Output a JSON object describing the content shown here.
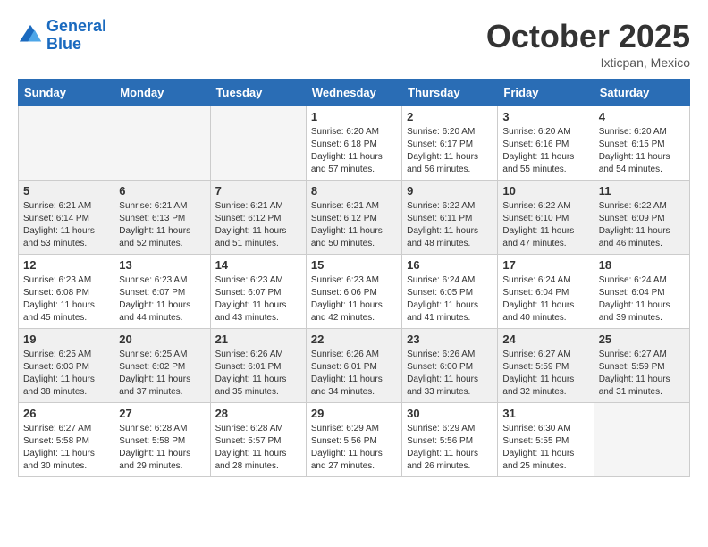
{
  "header": {
    "logo_line1": "General",
    "logo_line2": "Blue",
    "month": "October 2025",
    "location": "Ixticpan, Mexico"
  },
  "days_of_week": [
    "Sunday",
    "Monday",
    "Tuesday",
    "Wednesday",
    "Thursday",
    "Friday",
    "Saturday"
  ],
  "weeks": [
    [
      {
        "day": "",
        "info": ""
      },
      {
        "day": "",
        "info": ""
      },
      {
        "day": "",
        "info": ""
      },
      {
        "day": "1",
        "info": "Sunrise: 6:20 AM\nSunset: 6:18 PM\nDaylight: 11 hours and 57 minutes."
      },
      {
        "day": "2",
        "info": "Sunrise: 6:20 AM\nSunset: 6:17 PM\nDaylight: 11 hours and 56 minutes."
      },
      {
        "day": "3",
        "info": "Sunrise: 6:20 AM\nSunset: 6:16 PM\nDaylight: 11 hours and 55 minutes."
      },
      {
        "day": "4",
        "info": "Sunrise: 6:20 AM\nSunset: 6:15 PM\nDaylight: 11 hours and 54 minutes."
      }
    ],
    [
      {
        "day": "5",
        "info": "Sunrise: 6:21 AM\nSunset: 6:14 PM\nDaylight: 11 hours and 53 minutes."
      },
      {
        "day": "6",
        "info": "Sunrise: 6:21 AM\nSunset: 6:13 PM\nDaylight: 11 hours and 52 minutes."
      },
      {
        "day": "7",
        "info": "Sunrise: 6:21 AM\nSunset: 6:12 PM\nDaylight: 11 hours and 51 minutes."
      },
      {
        "day": "8",
        "info": "Sunrise: 6:21 AM\nSunset: 6:12 PM\nDaylight: 11 hours and 50 minutes."
      },
      {
        "day": "9",
        "info": "Sunrise: 6:22 AM\nSunset: 6:11 PM\nDaylight: 11 hours and 48 minutes."
      },
      {
        "day": "10",
        "info": "Sunrise: 6:22 AM\nSunset: 6:10 PM\nDaylight: 11 hours and 47 minutes."
      },
      {
        "day": "11",
        "info": "Sunrise: 6:22 AM\nSunset: 6:09 PM\nDaylight: 11 hours and 46 minutes."
      }
    ],
    [
      {
        "day": "12",
        "info": "Sunrise: 6:23 AM\nSunset: 6:08 PM\nDaylight: 11 hours and 45 minutes."
      },
      {
        "day": "13",
        "info": "Sunrise: 6:23 AM\nSunset: 6:07 PM\nDaylight: 11 hours and 44 minutes."
      },
      {
        "day": "14",
        "info": "Sunrise: 6:23 AM\nSunset: 6:07 PM\nDaylight: 11 hours and 43 minutes."
      },
      {
        "day": "15",
        "info": "Sunrise: 6:23 AM\nSunset: 6:06 PM\nDaylight: 11 hours and 42 minutes."
      },
      {
        "day": "16",
        "info": "Sunrise: 6:24 AM\nSunset: 6:05 PM\nDaylight: 11 hours and 41 minutes."
      },
      {
        "day": "17",
        "info": "Sunrise: 6:24 AM\nSunset: 6:04 PM\nDaylight: 11 hours and 40 minutes."
      },
      {
        "day": "18",
        "info": "Sunrise: 6:24 AM\nSunset: 6:04 PM\nDaylight: 11 hours and 39 minutes."
      }
    ],
    [
      {
        "day": "19",
        "info": "Sunrise: 6:25 AM\nSunset: 6:03 PM\nDaylight: 11 hours and 38 minutes."
      },
      {
        "day": "20",
        "info": "Sunrise: 6:25 AM\nSunset: 6:02 PM\nDaylight: 11 hours and 37 minutes."
      },
      {
        "day": "21",
        "info": "Sunrise: 6:26 AM\nSunset: 6:01 PM\nDaylight: 11 hours and 35 minutes."
      },
      {
        "day": "22",
        "info": "Sunrise: 6:26 AM\nSunset: 6:01 PM\nDaylight: 11 hours and 34 minutes."
      },
      {
        "day": "23",
        "info": "Sunrise: 6:26 AM\nSunset: 6:00 PM\nDaylight: 11 hours and 33 minutes."
      },
      {
        "day": "24",
        "info": "Sunrise: 6:27 AM\nSunset: 5:59 PM\nDaylight: 11 hours and 32 minutes."
      },
      {
        "day": "25",
        "info": "Sunrise: 6:27 AM\nSunset: 5:59 PM\nDaylight: 11 hours and 31 minutes."
      }
    ],
    [
      {
        "day": "26",
        "info": "Sunrise: 6:27 AM\nSunset: 5:58 PM\nDaylight: 11 hours and 30 minutes."
      },
      {
        "day": "27",
        "info": "Sunrise: 6:28 AM\nSunset: 5:58 PM\nDaylight: 11 hours and 29 minutes."
      },
      {
        "day": "28",
        "info": "Sunrise: 6:28 AM\nSunset: 5:57 PM\nDaylight: 11 hours and 28 minutes."
      },
      {
        "day": "29",
        "info": "Sunrise: 6:29 AM\nSunset: 5:56 PM\nDaylight: 11 hours and 27 minutes."
      },
      {
        "day": "30",
        "info": "Sunrise: 6:29 AM\nSunset: 5:56 PM\nDaylight: 11 hours and 26 minutes."
      },
      {
        "day": "31",
        "info": "Sunrise: 6:30 AM\nSunset: 5:55 PM\nDaylight: 11 hours and 25 minutes."
      },
      {
        "day": "",
        "info": ""
      }
    ]
  ]
}
